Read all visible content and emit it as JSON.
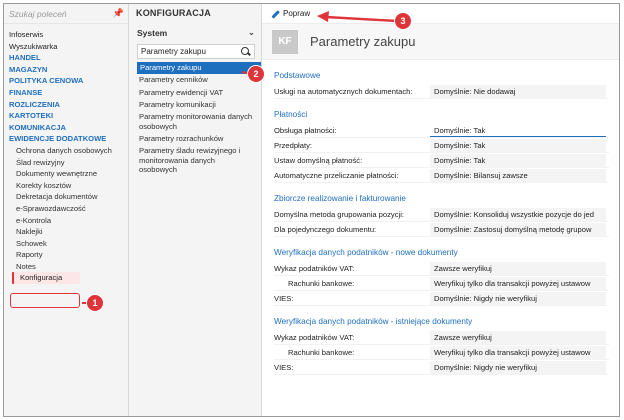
{
  "nav": {
    "search_placeholder": "Szukaj poleceń",
    "items": [
      {
        "label": "Infoserwis",
        "style": "normal"
      },
      {
        "label": "Wyszukiwarka",
        "style": "normal"
      },
      {
        "label": "HANDEL",
        "style": "blue"
      },
      {
        "label": "MAGAZYN",
        "style": "blue"
      },
      {
        "label": "POLITYKA CENOWA",
        "style": "blue"
      },
      {
        "label": "FINANSE",
        "style": "blue"
      },
      {
        "label": "ROZLICZENIA",
        "style": "blue"
      },
      {
        "label": "KARTOTEKI",
        "style": "blue"
      },
      {
        "label": "KOMUNIKACJA",
        "style": "blue"
      },
      {
        "label": "EWIDENCJE DODATKOWE",
        "style": "blue"
      },
      {
        "label": "Ochrona danych osobowych",
        "style": "sub"
      },
      {
        "label": "Ślad rewizyjny",
        "style": "sub"
      },
      {
        "label": "Dokumenty wewnętrzne",
        "style": "sub"
      },
      {
        "label": "Korekty kosztów",
        "style": "sub"
      },
      {
        "label": "Dekretacja dokumentów",
        "style": "sub"
      },
      {
        "label": "e-Sprawozdawczość",
        "style": "sub"
      },
      {
        "label": "e-Kontrola",
        "style": "sub"
      },
      {
        "label": "Naklejki",
        "style": "sub"
      },
      {
        "label": "Schowek",
        "style": "sub"
      },
      {
        "label": "Raporty",
        "style": "sub"
      },
      {
        "label": "Notes",
        "style": "sub"
      },
      {
        "label": "Konfiguracja",
        "style": "sel"
      }
    ]
  },
  "mid": {
    "title": "KONFIGURACJA",
    "group": "System",
    "search_value": "Parametry zakupu",
    "items": [
      {
        "label": "Parametry zakupu",
        "active": true
      },
      {
        "label": "Parametry cenników",
        "active": false
      },
      {
        "label": "Parametry ewidencji VAT",
        "active": false
      },
      {
        "label": "Parametry komunikacji",
        "active": false
      },
      {
        "label": "Parametry monitorowania danych osobowych",
        "active": false
      },
      {
        "label": "Parametry rozrachunków",
        "active": false
      },
      {
        "label": "Parametry śladu rewizyjnego i monitorowania danych osobowych",
        "active": false
      }
    ]
  },
  "toolbar": {
    "edit_label": "Popraw"
  },
  "header": {
    "badge": "KF",
    "title": "Parametry zakupu"
  },
  "sections": [
    {
      "title": "Podstawowe",
      "rows": [
        {
          "label": "Usługi na automatycznych dokumentach:",
          "value": "Domyślnie: Nie dodawaj"
        }
      ]
    },
    {
      "title": "Płatności",
      "rows": [
        {
          "label": "Obsługa płatności:",
          "value": "Domyślnie: Tak",
          "focus": true
        },
        {
          "label": "Przedpłaty:",
          "value": "Domyślnie: Tak"
        },
        {
          "label": "Ustaw domyślną płatność:",
          "value": "Domyślnie: Tak"
        },
        {
          "label": "Automatyczne przeliczanie płatności:",
          "value": "Domyślnie: Bilansuj zawsze"
        }
      ]
    },
    {
      "title": "Zbiorcze realizowanie i fakturowanie",
      "rows": [
        {
          "label": "Domyślna metoda grupowania pozycji:",
          "value": "Domyślnie: Konsoliduj wszystkie pozycje do jed"
        },
        {
          "label": "Dla pojedynczego dokumentu:",
          "value": "Domyślnie: Zastosuj domyślną metodę grupow"
        }
      ]
    },
    {
      "title": "Weryfikacja danych podatników - nowe dokumenty",
      "rows": [
        {
          "label": "Wykaz podatników VAT:",
          "value": "Zawsze weryfikuj"
        },
        {
          "label": "Rachunki bankowe:",
          "value": "Weryfikuj tylko dla transakcji powyżej ustawow",
          "indent": true
        },
        {
          "label": "VIES:",
          "value": "Domyślnie: Nigdy nie weryfikuj"
        }
      ]
    },
    {
      "title": "Weryfikacja danych podatników - istniejące dokumenty",
      "rows": [
        {
          "label": "Wykaz podatników VAT:",
          "value": "Zawsze weryfikuj"
        },
        {
          "label": "Rachunki bankowe:",
          "value": "Weryfikuj tylko dla transakcji powyżej ustawow",
          "indent": true
        },
        {
          "label": "VIES:",
          "value": "Domyślnie: Nigdy nie weryfikuj"
        }
      ]
    }
  ],
  "annotations": {
    "b1": "1",
    "b2": "2",
    "b3": "3",
    "color": "#e0343b"
  }
}
